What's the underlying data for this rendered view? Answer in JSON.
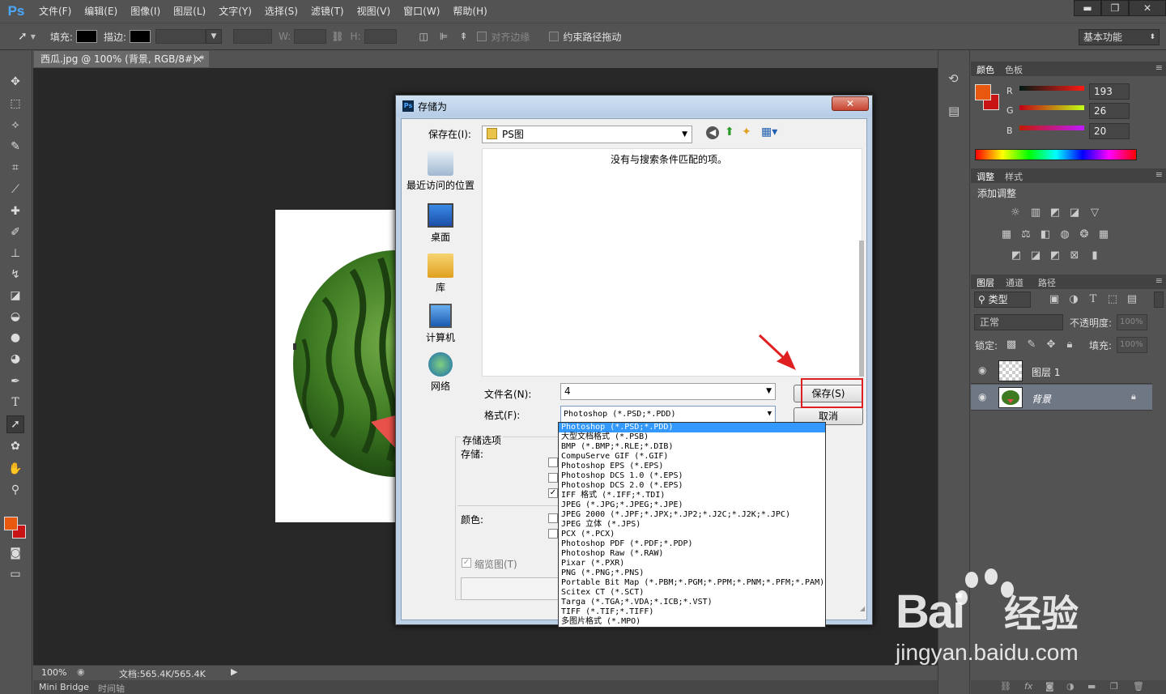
{
  "app": {
    "logo": "Ps"
  },
  "menu": [
    "文件(F)",
    "编辑(E)",
    "图像(I)",
    "图层(L)",
    "文字(Y)",
    "选择(S)",
    "滤镜(T)",
    "视图(V)",
    "窗口(W)",
    "帮助(H)"
  ],
  "window_controls": {
    "minimize": "▬",
    "restore": "❐",
    "close": "✕"
  },
  "options_bar": {
    "fill_label": "填充:",
    "stroke_label": "描边:",
    "w_label": "W:",
    "h_label": "H:",
    "align_edges": "对齐边缘",
    "constrain_path": "约束路径拖动",
    "workspace": "基本功能"
  },
  "document": {
    "tab_title": "西瓜.jpg @ 100% (背景, RGB/8#) *",
    "close": "×"
  },
  "status": {
    "zoom": "100%",
    "doc_info": "文档:565.4K/565.4K"
  },
  "bottom_tabs": [
    "Mini Bridge",
    "时间轴"
  ],
  "color_panel": {
    "tabs": [
      "颜色",
      "色板"
    ],
    "channels": [
      {
        "label": "R",
        "value": "193"
      },
      {
        "label": "G",
        "value": "26"
      },
      {
        "label": "B",
        "value": "20"
      }
    ],
    "foreground": "#e8580e",
    "background": "#c81414"
  },
  "adjustments_panel": {
    "tabs": [
      "调整",
      "样式"
    ],
    "title": "添加调整"
  },
  "layers_panel": {
    "tabs": [
      "图层",
      "通道",
      "路径"
    ],
    "filter": "类型",
    "blend_mode": "正常",
    "opacity_label": "不透明度:",
    "opacity_value": "100%",
    "lock_label": "锁定:",
    "fill_label": "填充:",
    "fill_value": "100%",
    "layers": [
      {
        "name": "图层 1",
        "selected": false
      },
      {
        "name": "背景",
        "selected": true
      }
    ]
  },
  "dialog": {
    "title": "存储为",
    "save_in_label": "保存在(I):",
    "save_in_value": "PS图",
    "empty_message": "没有与搜索条件匹配的项。",
    "places": [
      "最近访问的位置",
      "桌面",
      "库",
      "计算机",
      "网络"
    ],
    "filename_label": "文件名(N):",
    "filename_value": "4",
    "format_label": "格式(F):",
    "format_value": "Photoshop (*.PSD;*.PDD)",
    "save_button": "保存(S)",
    "cancel_button": "取消",
    "save_options_label": "存储选项",
    "storage_label": "存储:",
    "color_label": "颜色:",
    "thumbnail_label": "缩览图(T)",
    "close": "✕"
  },
  "format_list": [
    "Photoshop (*.PSD;*.PDD)",
    "大型文档格式 (*.PSB)",
    "BMP (*.BMP;*.RLE;*.DIB)",
    "CompuServe GIF (*.GIF)",
    "Photoshop EPS (*.EPS)",
    "Photoshop DCS 1.0 (*.EPS)",
    "Photoshop DCS 2.0 (*.EPS)",
    "IFF 格式 (*.IFF;*.TDI)",
    "JPEG (*.JPG;*.JPEG;*.JPE)",
    "JPEG 2000 (*.JPF;*.JPX;*.JP2;*.J2C;*.J2K;*.JPC)",
    "JPEG 立体 (*.JPS)",
    "PCX (*.PCX)",
    "Photoshop PDF (*.PDF;*.PDP)",
    "Photoshop Raw (*.RAW)",
    "Pixar (*.PXR)",
    "PNG (*.PNG;*.PNS)",
    "Portable Bit Map (*.PBM;*.PGM;*.PPM;*.PNM;*.PFM;*.PAM)",
    "Scitex CT (*.SCT)",
    "Targa (*.TGA;*.VDA;*.ICB;*.VST)",
    "TIFF (*.TIF;*.TIFF)",
    "多图片格式 (*.MPO)"
  ],
  "watermark": {
    "brand": "Bai",
    "product": "经验",
    "url": "jingyan.baidu.com"
  }
}
